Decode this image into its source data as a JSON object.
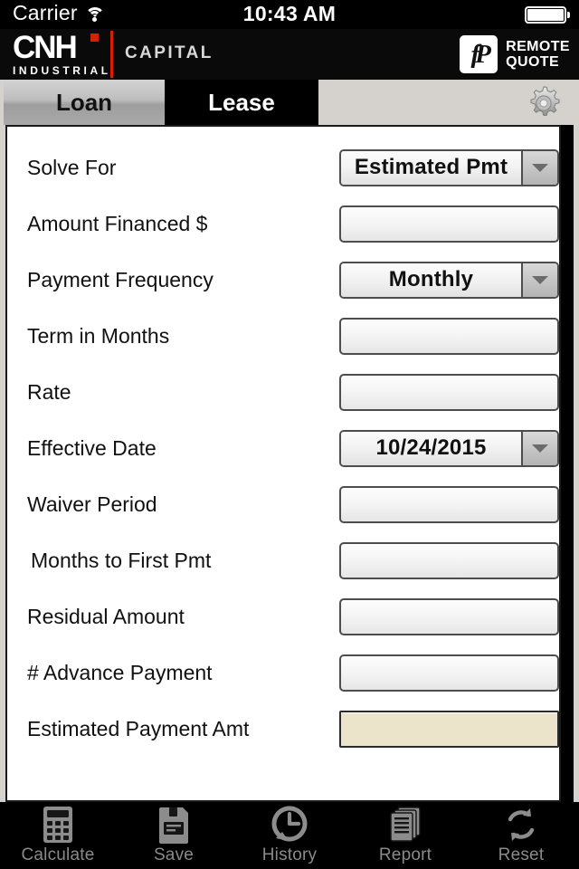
{
  "status_bar": {
    "carrier": "Carrier",
    "wifi_icon": "wifi-icon",
    "time": "10:43 AM",
    "battery_icon": "battery-full-icon"
  },
  "brand_bar": {
    "logo_main": "CNH",
    "logo_sub": "INDUSTRIAL",
    "logo_division": "CAPITAL",
    "app_mark_glyph": "fP",
    "app_name_line1": "REMOTE",
    "app_name_line2": "QUOTE",
    "accent_red": "#d81e05"
  },
  "tabs": {
    "items": [
      {
        "label": "Loan",
        "active": true
      },
      {
        "label": "Lease",
        "active": false
      }
    ],
    "settings_icon": "gear-icon"
  },
  "form": {
    "rows": [
      {
        "label": "Solve For",
        "type": "dropdown",
        "value": "Estimated Pmt"
      },
      {
        "label": "Amount Financed $",
        "type": "text",
        "value": ""
      },
      {
        "label": "Payment Frequency",
        "type": "dropdown",
        "value": "Monthly"
      },
      {
        "label": "Term in Months",
        "type": "text",
        "value": ""
      },
      {
        "label": "Rate",
        "type": "text",
        "value": ""
      },
      {
        "label": "Effective Date",
        "type": "dropdown",
        "value": "10/24/2015"
      },
      {
        "label": "Waiver Period",
        "type": "text",
        "value": ""
      },
      {
        "label": "Months to First Pmt",
        "type": "text",
        "value": ""
      },
      {
        "label": "Residual Amount",
        "type": "text",
        "value": ""
      },
      {
        "label": "# Advance Payment",
        "type": "text",
        "value": ""
      },
      {
        "label": "Estimated Payment Amt",
        "type": "result",
        "value": ""
      }
    ],
    "result_field_color": "#ece4ca"
  },
  "toolbar": {
    "items": [
      {
        "label": "Calculate",
        "icon": "calculator-icon"
      },
      {
        "label": "Save",
        "icon": "floppy-disk-icon"
      },
      {
        "label": "History",
        "icon": "clock-history-icon"
      },
      {
        "label": "Report",
        "icon": "documents-icon"
      },
      {
        "label": "Reset",
        "icon": "refresh-icon"
      }
    ]
  }
}
